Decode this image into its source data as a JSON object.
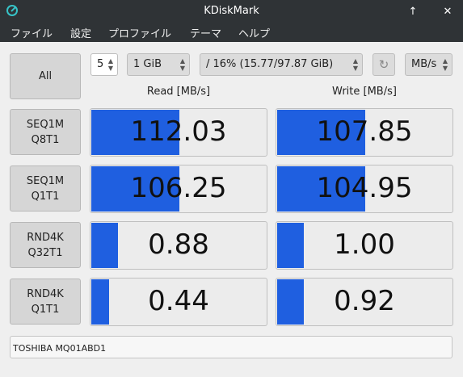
{
  "window": {
    "title": "KDiskMark"
  },
  "menu": [
    "ファイル",
    "設定",
    "プロファイル",
    "テーマ",
    "ヘルプ"
  ],
  "controls": {
    "all_label": "All",
    "runs": "5",
    "size": "1 GiB",
    "target": "/ 16% (15.77/97.87 GiB)",
    "unit": "MB/s"
  },
  "headers": {
    "read": "Read [MB/s]",
    "write": "Write [MB/s]"
  },
  "rows": [
    {
      "line1": "SEQ1M",
      "line2": "Q8T1",
      "read": "112.03",
      "write": "107.85",
      "read_fill": 0.5,
      "write_fill": 0.5
    },
    {
      "line1": "SEQ1M",
      "line2": "Q1T1",
      "read": "106.25",
      "write": "104.95",
      "read_fill": 0.5,
      "write_fill": 0.5
    },
    {
      "line1": "RND4K",
      "line2": "Q32T1",
      "read": "0.88",
      "write": "1.00",
      "read_fill": 0.15,
      "write_fill": 0.15
    },
    {
      "line1": "RND4K",
      "line2": "Q1T1",
      "read": "0.44",
      "write": "0.92",
      "read_fill": 0.1,
      "write_fill": 0.15
    }
  ],
  "device": "TOSHIBA MQ01ABD1",
  "colors": {
    "bar": "#1f5fe0",
    "titlebar": "#2f3336",
    "icon": "#37c4c8"
  },
  "icons": {
    "app": "disk-icon",
    "up": "arrow-up-icon",
    "close": "close-icon",
    "refresh": "refresh-icon"
  }
}
